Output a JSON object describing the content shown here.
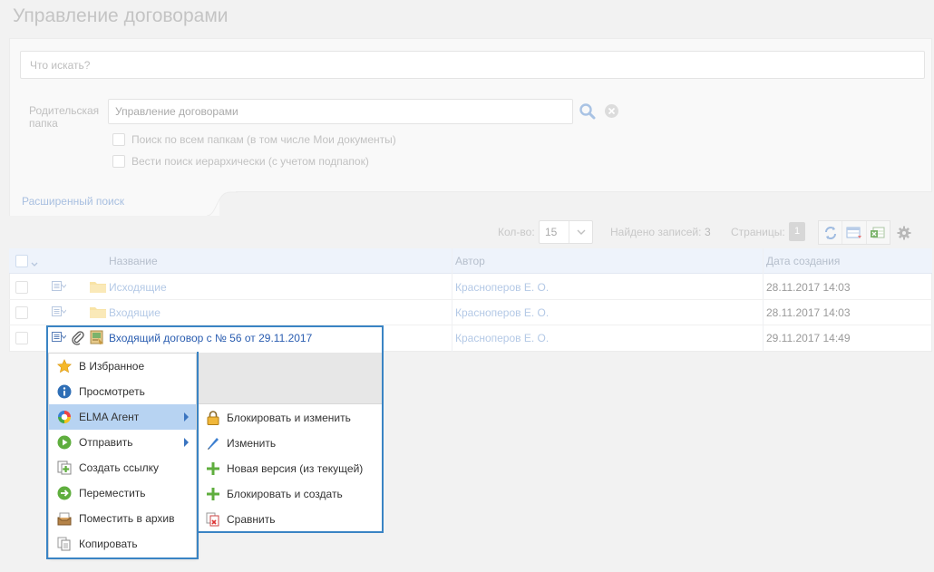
{
  "header": {
    "title": "Управление договорами"
  },
  "search": {
    "placeholder": "Что искать?",
    "parent_folder_label": "Родительская папка",
    "parent_folder_value": "Управление договорами",
    "checkbox_all_folders": "Поиск по всем папкам (в том числе Мои документы)",
    "checkbox_hierarchical": "Вести поиск иерархически (с учетом подпапок)",
    "advanced_link": "Расширенный поиск"
  },
  "pager": {
    "per_page_label": "Кол-во:",
    "per_page_value": "15",
    "found_label": "Найдено записей:",
    "found_value": "3",
    "pages_label": "Страницы:",
    "current_page": "1"
  },
  "table": {
    "columns": {
      "name": "Название",
      "author": "Автор",
      "created": "Дата создания"
    },
    "rows": [
      {
        "name": "Исходящие",
        "author": "Красноперов Е. О.",
        "created": "28.11.2017 14:03"
      },
      {
        "name": "Входящие",
        "author": "Красноперов Е. О.",
        "created": "28.11.2017 14:03"
      },
      {
        "name": "Входящий договор с № 56 от 29.11.2017",
        "author": "Красноперов Е. О.",
        "created": "29.11.2017 14:49"
      }
    ]
  },
  "context_menu": {
    "items": [
      {
        "label": "В Избранное",
        "icon": "star-icon"
      },
      {
        "label": "Просмотреть",
        "icon": "info-icon"
      },
      {
        "label": "ELMA Агент",
        "icon": "elma-agent-icon"
      },
      {
        "label": "Отправить",
        "icon": "send-icon"
      },
      {
        "label": "Создать ссылку",
        "icon": "create-link-icon"
      },
      {
        "label": "Переместить",
        "icon": "move-icon"
      },
      {
        "label": "Поместить в архив",
        "icon": "archive-icon"
      },
      {
        "label": "Копировать",
        "icon": "copy-icon"
      }
    ],
    "submenu": [
      {
        "label": "Блокировать и изменить",
        "icon": "lock-icon"
      },
      {
        "label": "Изменить",
        "icon": "pencil-icon"
      },
      {
        "label": "Новая версия (из текущей)",
        "icon": "plus-icon"
      },
      {
        "label": "Блокировать и создать",
        "icon": "plus-icon"
      },
      {
        "label": "Сравнить",
        "icon": "compare-icon"
      }
    ]
  },
  "colors": {
    "accent_blue": "#3a84c4",
    "link_blue": "#2a5db0",
    "menu_active": "#b7d3f2",
    "folder_yellow": "#f6d77b"
  }
}
